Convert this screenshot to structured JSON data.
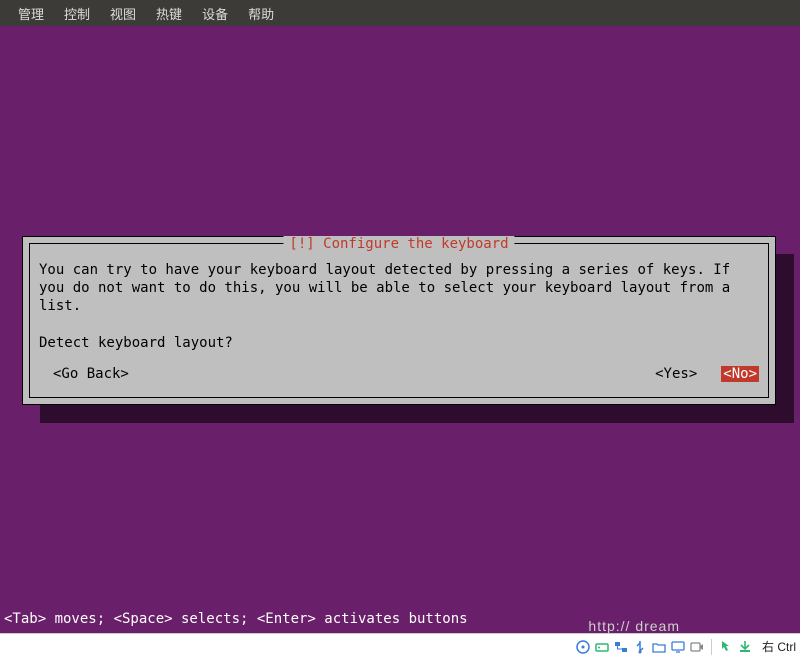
{
  "menubar": {
    "items": [
      "管理",
      "控制",
      "视图",
      "热键",
      "设备",
      "帮助"
    ]
  },
  "dialog": {
    "title": "[!] Configure the keyboard",
    "body_line1": "You can try to have your keyboard layout detected by pressing a series of keys. If you do not want to do this, you will be able to select your keyboard layout from a list.",
    "body_line2": "Detect keyboard layout?",
    "go_back": "<Go Back>",
    "yes": "<Yes>",
    "no": "<No>"
  },
  "help_bar": "<Tab> moves; <Space> selects; <Enter> activates buttons",
  "statusbar": {
    "watermark": "http://                    dream",
    "hostkey": "右 Ctrl"
  }
}
